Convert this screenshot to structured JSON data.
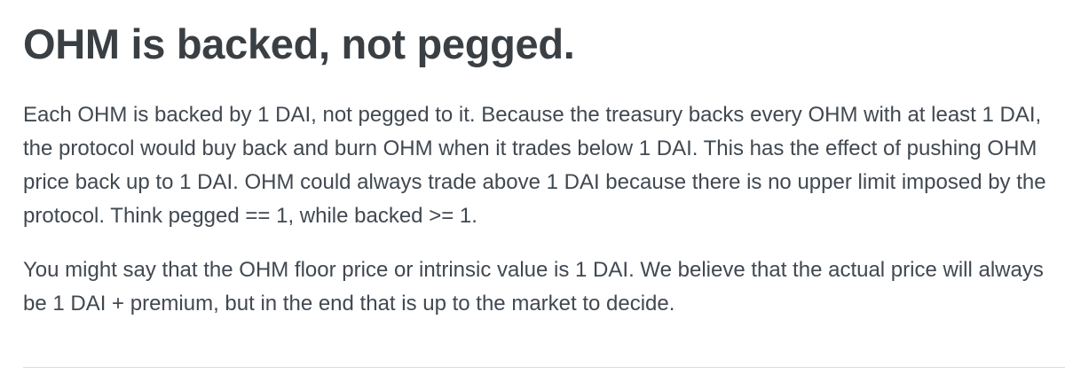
{
  "article": {
    "title": "OHM is backed, not pegged.",
    "paragraphs": [
      "Each OHM is backed by 1 DAI, not pegged to it. Because the treasury backs every OHM with at least 1 DAI, the protocol would buy back and burn OHM when it trades below 1 DAI. This has the effect of pushing OHM price back up to 1 DAI. OHM could always trade above 1 DAI because there is no upper limit imposed by the protocol. Think pegged == 1, while backed >= 1.",
      "You might say that the OHM floor price or intrinsic value is 1 DAI. We believe that the actual price will always be 1 DAI + premium, but in the end that is up to the market to decide."
    ]
  },
  "colors": {
    "heading": "#3a3f44",
    "body_text": "#414850",
    "divider": "#dcdcdc",
    "background": "#ffffff"
  }
}
